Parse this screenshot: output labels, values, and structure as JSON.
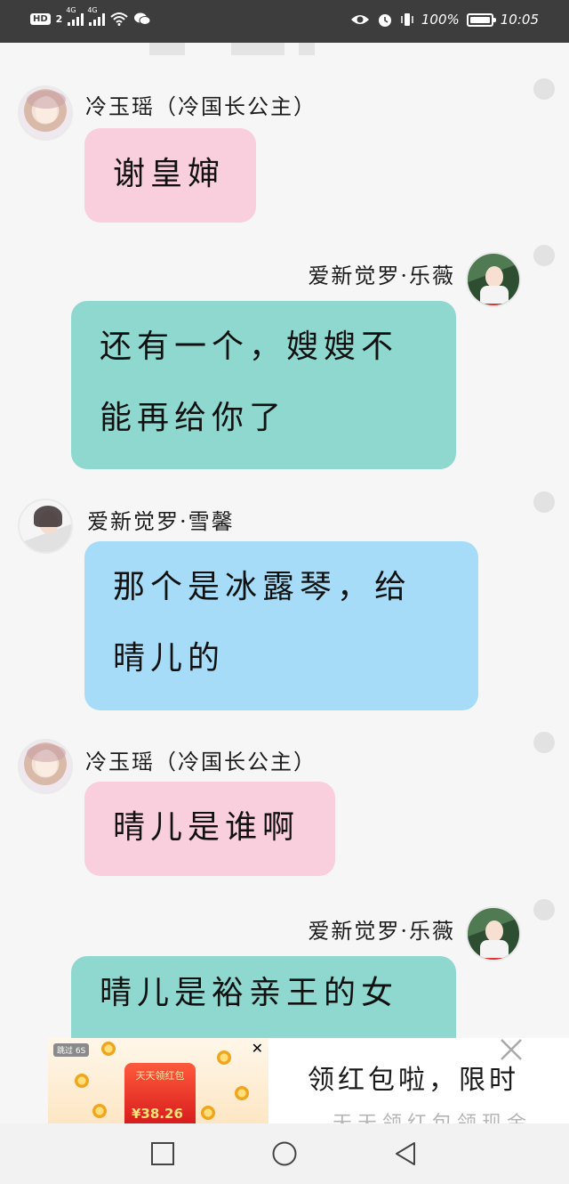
{
  "status_bar": {
    "hd": "HD",
    "sim": "2",
    "net1": "4G",
    "net2": "4G",
    "battery": "100%",
    "time": "10:05"
  },
  "messages": [
    {
      "sender": "冷玉瑶（冷国长公主）",
      "avatar": "pink-hair-avatar",
      "text": "谢皇婶"
    },
    {
      "sender": "爱新觉罗·乐薇",
      "avatar": "red-dress-girl-avatar",
      "lines": [
        "还有一个，嫂嫂不",
        "能再给你了"
      ]
    },
    {
      "sender": "爱新觉罗·雪馨",
      "avatar": "white-hair-girl-avatar",
      "lines": [
        "那个是冰露琴，给",
        "晴儿的"
      ]
    },
    {
      "sender": "冷玉瑶（冷国长公主）",
      "avatar": "pink-hair-avatar",
      "text": "晴儿是谁啊"
    },
    {
      "sender": "爱新觉罗·乐薇",
      "avatar": "red-dress-girl-avatar",
      "text": "晴儿是裕亲王的女"
    }
  ],
  "ad": {
    "badge": "跳过 6S",
    "envelope_title": "天天领红包",
    "amount": "¥38.26",
    "headline": "领红包啦，限时",
    "subline": "天天领红包领现金"
  },
  "colors": {
    "pink_bubble": "#f9cfdd",
    "teal_bubble": "#8fd8cf",
    "blue_bubble": "#a6dcf7",
    "status_bar": "#3d3d3d"
  }
}
